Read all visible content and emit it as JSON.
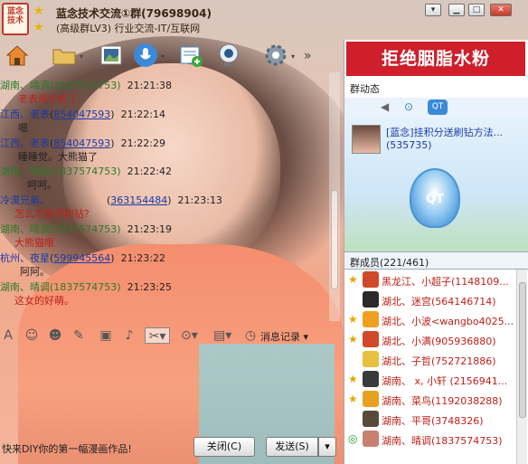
{
  "window": {
    "logo_text": "蓝念技术",
    "title": "蓝念技术交流①群(79698904)",
    "subtitle": "(高级群LV3) 行业交流-IT/互联网"
  },
  "toolbar": {
    "more_label": "»"
  },
  "messages": [
    {
      "sender": "湖南、晴调",
      "id": "(1837574753)",
      "time": "21:21:38",
      "body": "老表用手机了,",
      "color": "#2a7a2a"
    },
    {
      "sender": "江西、老表",
      "id": "854047593",
      "time": "21:22:14",
      "body": "嗯",
      "color": "#1a3aa8"
    },
    {
      "sender": "江西、老表",
      "id": "854047593",
      "time": "21:22:29",
      "body": "睡睡觉。大熊猫了",
      "color": "#1a3aa8"
    },
    {
      "sender": "湖南、晴调",
      "id": "(1837574753)",
      "time": "21:22:42",
      "body": "呵呵。",
      "color": "#2a7a2a"
    },
    {
      "sender": "冷漠兄弟。",
      "id": "363154484",
      "time": "21:23:13",
      "body": "怎么才能学刷钻?",
      "color": "#1a3aa8"
    },
    {
      "sender": "湖南、晴调",
      "id": "(1837574753)",
      "time": "21:23:19",
      "body": "大熊猫哦",
      "color": "#2a7a2a"
    },
    {
      "sender": "杭州、夜星",
      "id": "599945564",
      "time": "21:23:22",
      "body": "阿阿。",
      "color": "#1a3aa8"
    },
    {
      "sender": "湖南、晴调",
      "id": "(1837574753)",
      "time": "21:23:25",
      "body": "这女的好萌。",
      "color": "#2a7a2a"
    }
  ],
  "format_bar": {
    "history_label": "消息记录"
  },
  "footer": {
    "ad_text": "快来DIY你的第一幅漫画作品!",
    "close_label": "关闭(C)",
    "send_label": "发送(S)"
  },
  "right_panel": {
    "banner_text": "拒绝胭脂水粉",
    "group_news_label": "群动态",
    "group_post_title": "[蓝念]挂积分送刷钻方法...",
    "group_post_id": "(535735)",
    "qt_label": "QT",
    "members_label": "群成员(221/461)",
    "members": [
      {
        "name": "黑龙江、小超子(1148109...",
        "role": "star",
        "avatar": "#d04a2a"
      },
      {
        "name": "湖北、迷宫(564146714)",
        "role": "none",
        "avatar": "#2a2a2a"
      },
      {
        "name": "湖北、小波<wangbo4025...",
        "role": "star",
        "avatar": "#f0a020"
      },
      {
        "name": "湖北、小满(905936880)",
        "role": "star",
        "avatar": "#d04a2a"
      },
      {
        "name": "湖北、子哲(752721886)",
        "role": "none",
        "avatar": "#e8c040"
      },
      {
        "name": "湖南、 x, 小轩 (2156941...",
        "role": "star",
        "avatar": "#3a3a3a"
      },
      {
        "name": "湖南、菜鸟(1192038288)",
        "role": "star",
        "avatar": "#e8a020"
      },
      {
        "name": "湖南、平哥(3748326)",
        "role": "none",
        "avatar": "#5a4a3a"
      },
      {
        "name": "湖南、晴调(1837574753)",
        "role": "chat",
        "avatar": "#c98070"
      }
    ]
  }
}
